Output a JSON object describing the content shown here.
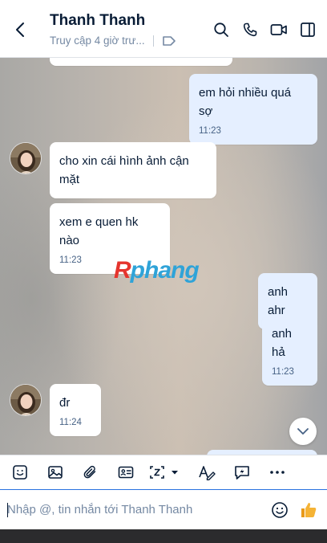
{
  "header": {
    "contact_name": "Thanh Thanh",
    "status": "Truy cập 4 giờ trư..."
  },
  "messages": [
    {
      "side": "them",
      "text": "cho xin cái hình ảnh cận mặt"
    },
    {
      "side": "them",
      "text": "xem e quen hk nào",
      "time": "11:23"
    },
    {
      "side": "them",
      "text": "đr",
      "time": "11:24"
    },
    {
      "side": "me",
      "text": "em hỏi nhiều quá sợ",
      "time": "11:23"
    },
    {
      "side": "me",
      "text": "anh ahr"
    },
    {
      "side": "me",
      "text": "anh hả",
      "time": "11:23"
    }
  ],
  "watermark": {
    "first": "R",
    "rest": "phang"
  },
  "composer": {
    "placeholder": "Nhập @, tin nhắn tới Thanh Thanh"
  },
  "colors": {
    "accent": "#2a72e0",
    "my_bubble": "#e5efff",
    "their_bubble": "#ffffff",
    "like": "#f5a623"
  },
  "icons": {
    "header": [
      "back-icon",
      "search-icon",
      "phone-icon",
      "video-icon",
      "sidebar-toggle-icon",
      "tag-icon"
    ],
    "toolbar": [
      "sticker-icon",
      "image-icon",
      "attachment-icon",
      "contact-card-icon",
      "screenshot-icon",
      "text-format-icon",
      "quick-message-icon",
      "more-icon"
    ],
    "composer": [
      "emoji-icon",
      "thumbs-up-icon"
    ]
  }
}
